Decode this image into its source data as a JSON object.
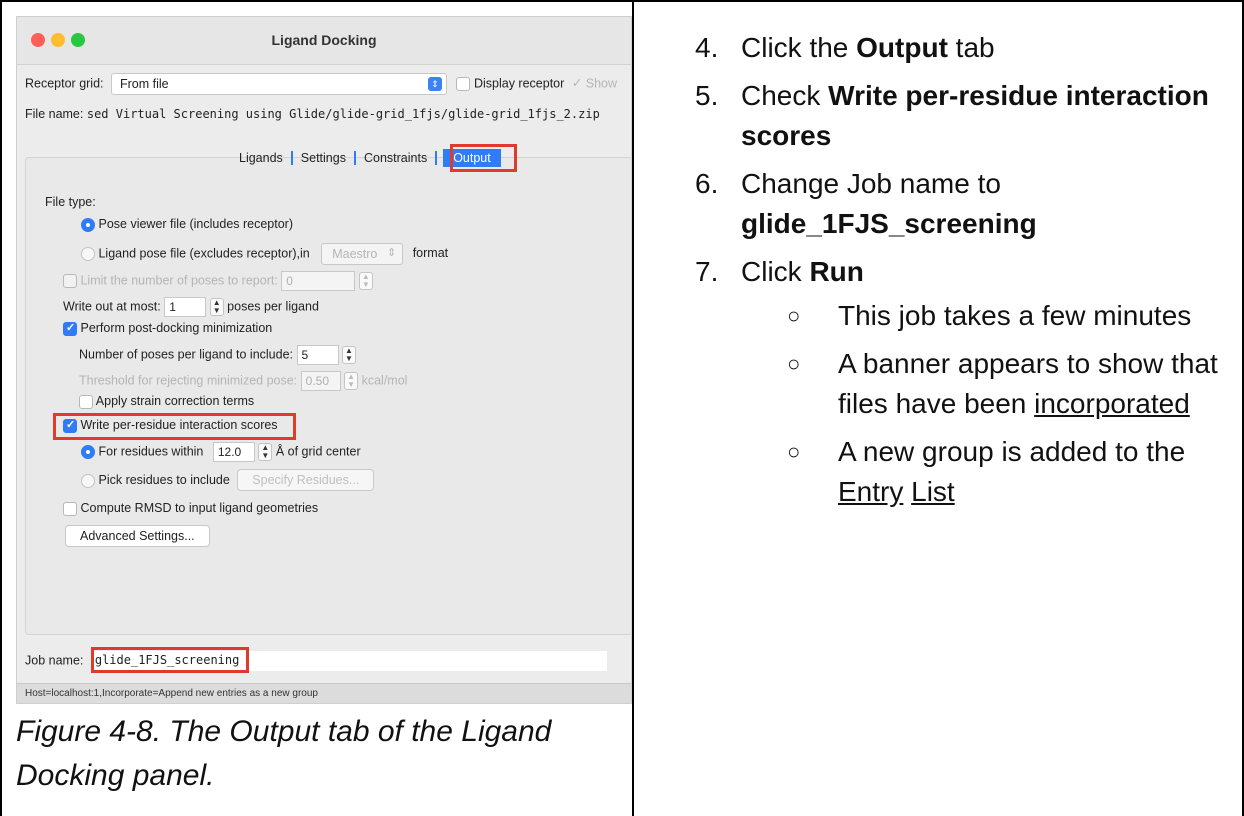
{
  "window": {
    "title": "Ligand Docking"
  },
  "receptor": {
    "label": "Receptor grid:",
    "value": "From file",
    "display_receptor": "Display receptor",
    "show_clip": "Show"
  },
  "file": {
    "label": "File name:",
    "value": "sed Virtual Screening using Glide/glide-grid_1fjs/glide-grid_1fjs_2.zip"
  },
  "tabs": [
    "Ligands",
    "Settings",
    "Constraints",
    "Output"
  ],
  "output": {
    "file_type_label": "File type:",
    "pose_viewer": "Pose viewer file (includes receptor)",
    "ligand_pose": "Ligand pose file (excludes receptor),in",
    "format_value": "Maestro",
    "format_label": "format",
    "limit_poses": "Limit the number of poses to report:",
    "limit_value": "0",
    "write_out_label": "Write out at most:",
    "write_out_value": "1",
    "poses_per_ligand": "poses per ligand",
    "post_docking": "Perform post-docking minimization",
    "num_poses_label": "Number of poses per ligand to include:",
    "num_poses_value": "5",
    "threshold_label": "Threshold for rejecting minimized pose:",
    "threshold_value": "0.50",
    "threshold_unit": "kcal/mol",
    "strain": "Apply strain correction terms",
    "per_residue": "Write per-residue interaction scores",
    "for_residues": "For residues within",
    "residue_value": "12.0",
    "grid_center": "Å of grid center",
    "pick_residues": "Pick residues to include",
    "specify_btn": "Specify Residues...",
    "rmsd": "Compute RMSD to input ligand geometries",
    "advanced_btn": "Advanced Settings..."
  },
  "job": {
    "label": "Job name:",
    "value": "glide_1FJS_screening"
  },
  "status": "Host=localhost:1,Incorporate=Append new entries as a new group",
  "caption": "Figure 4-8. The Output tab of the Ligand Docking panel.",
  "steps": {
    "s4": {
      "num": "4.",
      "pre": "Click the ",
      "bold": "Output",
      "post": " tab"
    },
    "s5": {
      "num": "5.",
      "pre": "Check ",
      "bold": "Write per-residue interaction scores"
    },
    "s6": {
      "num": "6.",
      "pre": "Change Job name to",
      "bold": "glide_1FJS_screening"
    },
    "s7": {
      "num": "7.",
      "pre": "Click ",
      "bold": "Run"
    },
    "sub1": "This job takes a few minutes",
    "sub2_pre": "A banner appears to show that files have been ",
    "sub2_link": "incorporated",
    "sub3_pre": "A new group is added to the ",
    "sub3_link1": "Entry",
    "sub3_link2": "List",
    "bullet": "○"
  }
}
